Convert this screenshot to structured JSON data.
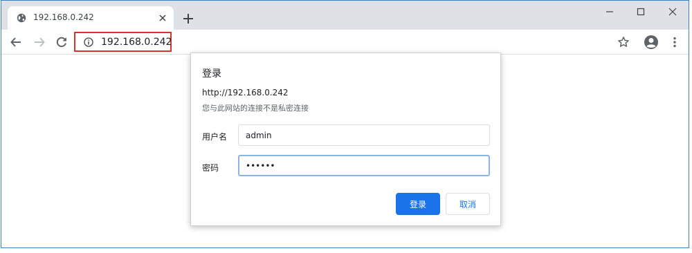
{
  "browser": {
    "tab": {
      "title": "192.168.0.242",
      "favicon": "globe-icon"
    },
    "address": "192.168.0.242",
    "accent": "#1a73e8",
    "highlight": "#e0302b"
  },
  "dialog": {
    "title": "登录",
    "url": "http://192.168.0.242",
    "warning": "您与此网站的连接不是私密连接",
    "username_label": "用户名",
    "username_value": "admin",
    "password_label": "密码",
    "password_value": "••••••",
    "login_button": "登录",
    "cancel_button": "取消"
  }
}
